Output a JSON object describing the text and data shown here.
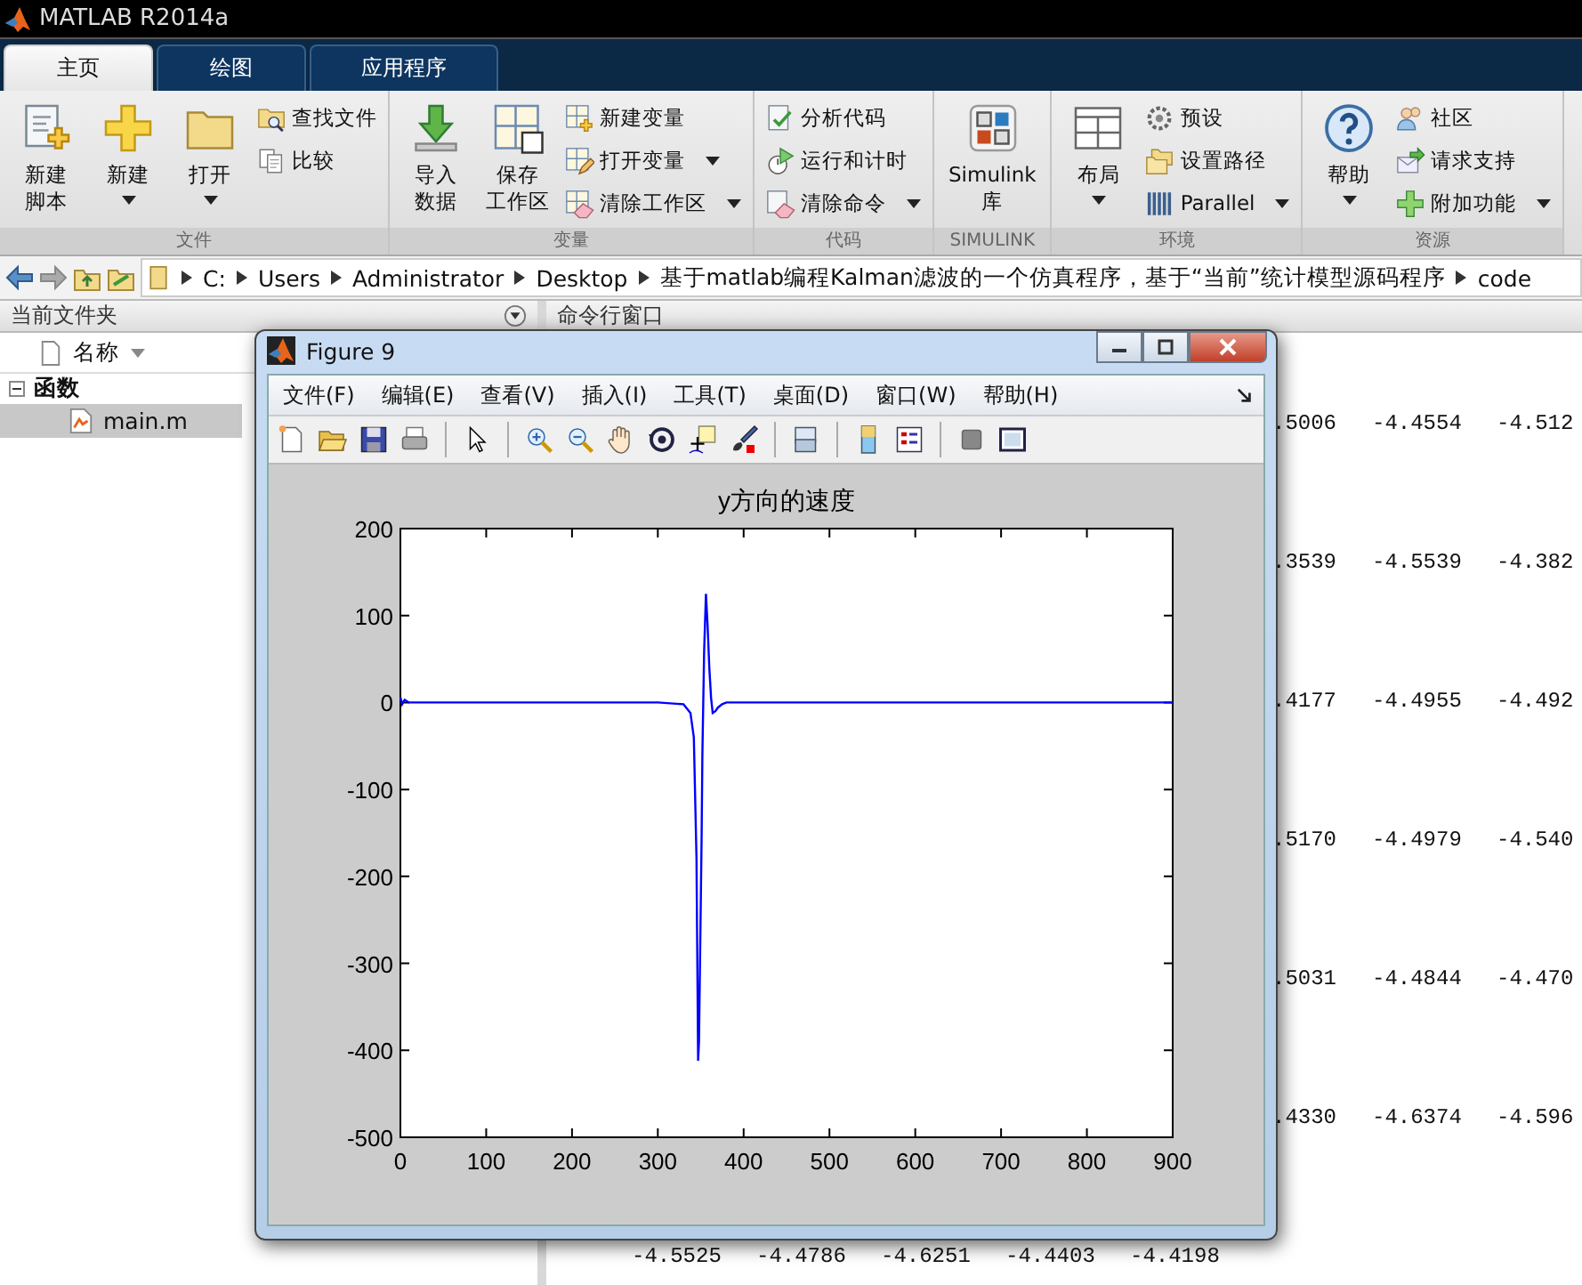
{
  "window": {
    "title": "MATLAB R2014a"
  },
  "tabs": [
    {
      "label": "主页",
      "selected": true
    },
    {
      "label": "绘图",
      "selected": false
    },
    {
      "label": "应用程序",
      "selected": false
    }
  ],
  "ribbon": {
    "groups": [
      {
        "label": "文件",
        "columns": [
          {
            "kind": "large",
            "lines": [
              "新建",
              "脚本"
            ],
            "dropdown": false
          },
          {
            "kind": "large",
            "lines": [
              "新建"
            ],
            "dropdown": true
          },
          {
            "kind": "large",
            "lines": [
              "打开"
            ],
            "dropdown": true
          },
          {
            "kind": "stack",
            "items": [
              {
                "label": "查找文件",
                "dropdown": false
              },
              {
                "label": "比较",
                "dropdown": false
              }
            ]
          }
        ]
      },
      {
        "label": "变量",
        "columns": [
          {
            "kind": "large",
            "lines": [
              "导入",
              "数据"
            ],
            "dropdown": false
          },
          {
            "kind": "large",
            "lines": [
              "保存",
              "工作区"
            ],
            "dropdown": false
          },
          {
            "kind": "stack",
            "items": [
              {
                "label": "新建变量",
                "dropdown": false
              },
              {
                "label": "打开变量",
                "dropdown": true
              },
              {
                "label": "清除工作区",
                "dropdown": true
              }
            ]
          }
        ]
      },
      {
        "label": "代码",
        "columns": [
          {
            "kind": "stack",
            "items": [
              {
                "label": "分析代码",
                "dropdown": false
              },
              {
                "label": "运行和计时",
                "dropdown": false
              },
              {
                "label": "清除命令",
                "dropdown": true
              }
            ]
          }
        ]
      },
      {
        "label": "SIMULINK",
        "columns": [
          {
            "kind": "large",
            "lines": [
              "Simulink",
              "库"
            ],
            "dropdown": false
          }
        ]
      },
      {
        "label": "环境",
        "columns": [
          {
            "kind": "large",
            "lines": [
              "布局"
            ],
            "dropdown": true
          },
          {
            "kind": "stack",
            "items": [
              {
                "label": "预设",
                "dropdown": false
              },
              {
                "label": "设置路径",
                "dropdown": false
              },
              {
                "label": "Parallel",
                "dropdown": true
              }
            ]
          }
        ]
      },
      {
        "label": "资源",
        "columns": [
          {
            "kind": "large",
            "lines": [
              "帮助"
            ],
            "dropdown": true
          },
          {
            "kind": "stack",
            "items": [
              {
                "label": "社区",
                "dropdown": false
              },
              {
                "label": "请求支持",
                "dropdown": false
              },
              {
                "label": "附加功能",
                "dropdown": true
              }
            ]
          }
        ]
      }
    ]
  },
  "address_bar": {
    "segments": [
      "C:",
      "Users",
      "Administrator",
      "Desktop",
      "基于matlab编程Kalman滤波的一个仿真程序，基于“当前”统计模型源码程序",
      "code"
    ]
  },
  "current_folder": {
    "title": "当前文件夹",
    "column": "名称",
    "tree": [
      {
        "label": "函数",
        "expanded": true,
        "selected": false,
        "children": [
          {
            "label": "main.m",
            "selected": true
          }
        ]
      }
    ]
  },
  "command_window": {
    "title": "命令行窗口",
    "rows": [
      {
        "kind": "tail",
        "cells": [
          ".5006",
          "-4.4554",
          "-4.512"
        ]
      },
      {
        "kind": "tail",
        "cells": [
          ".3539",
          "-4.5539",
          "-4.382"
        ]
      },
      {
        "kind": "tail",
        "cells": [
          ".4177",
          "-4.4955",
          "-4.492"
        ]
      },
      {
        "kind": "tail",
        "cells": [
          ".5170",
          "-4.4979",
          "-4.540"
        ]
      },
      {
        "kind": "tail",
        "cells": [
          ".5031",
          "-4.4844",
          "-4.470"
        ]
      },
      {
        "kind": "tail",
        "cells": [
          ".4330",
          "-4.6374",
          "-4.596"
        ]
      },
      {
        "kind": "full",
        "cells": [
          "-4.5525",
          "-4.4786",
          "-4.6251",
          "-4.4403",
          "-4.4198"
        ]
      }
    ]
  },
  "figure": {
    "title": "Figure 9",
    "menu": [
      "文件(F)",
      "编辑(E)",
      "查看(V)",
      "插入(I)",
      "工具(T)",
      "桌面(D)",
      "窗口(W)",
      "帮助(H)"
    ],
    "chart_data": {
      "type": "line",
      "title": "y方向的速度",
      "xlim": [
        0,
        900
      ],
      "ylim": [
        -500,
        200
      ],
      "xticks": [
        0,
        100,
        200,
        300,
        400,
        500,
        600,
        700,
        800,
        900
      ],
      "yticks": [
        -500,
        -400,
        -300,
        -200,
        -100,
        0,
        100,
        200
      ],
      "x": [
        0,
        2,
        5,
        10,
        20,
        300,
        330,
        338,
        342,
        345,
        347,
        348,
        350,
        351,
        352,
        354,
        356,
        358,
        360,
        362,
        364,
        367,
        370,
        375,
        380,
        390,
        900
      ],
      "series": [
        {
          "color": "#0000ff",
          "values": [
            6,
            -2,
            3,
            0,
            0,
            0,
            -2,
            -12,
            -40,
            -180,
            -412,
            -390,
            -230,
            -150,
            -60,
            60,
            125,
            90,
            40,
            5,
            -12,
            -10,
            -6,
            -2,
            0,
            0,
            0
          ]
        }
      ]
    }
  }
}
